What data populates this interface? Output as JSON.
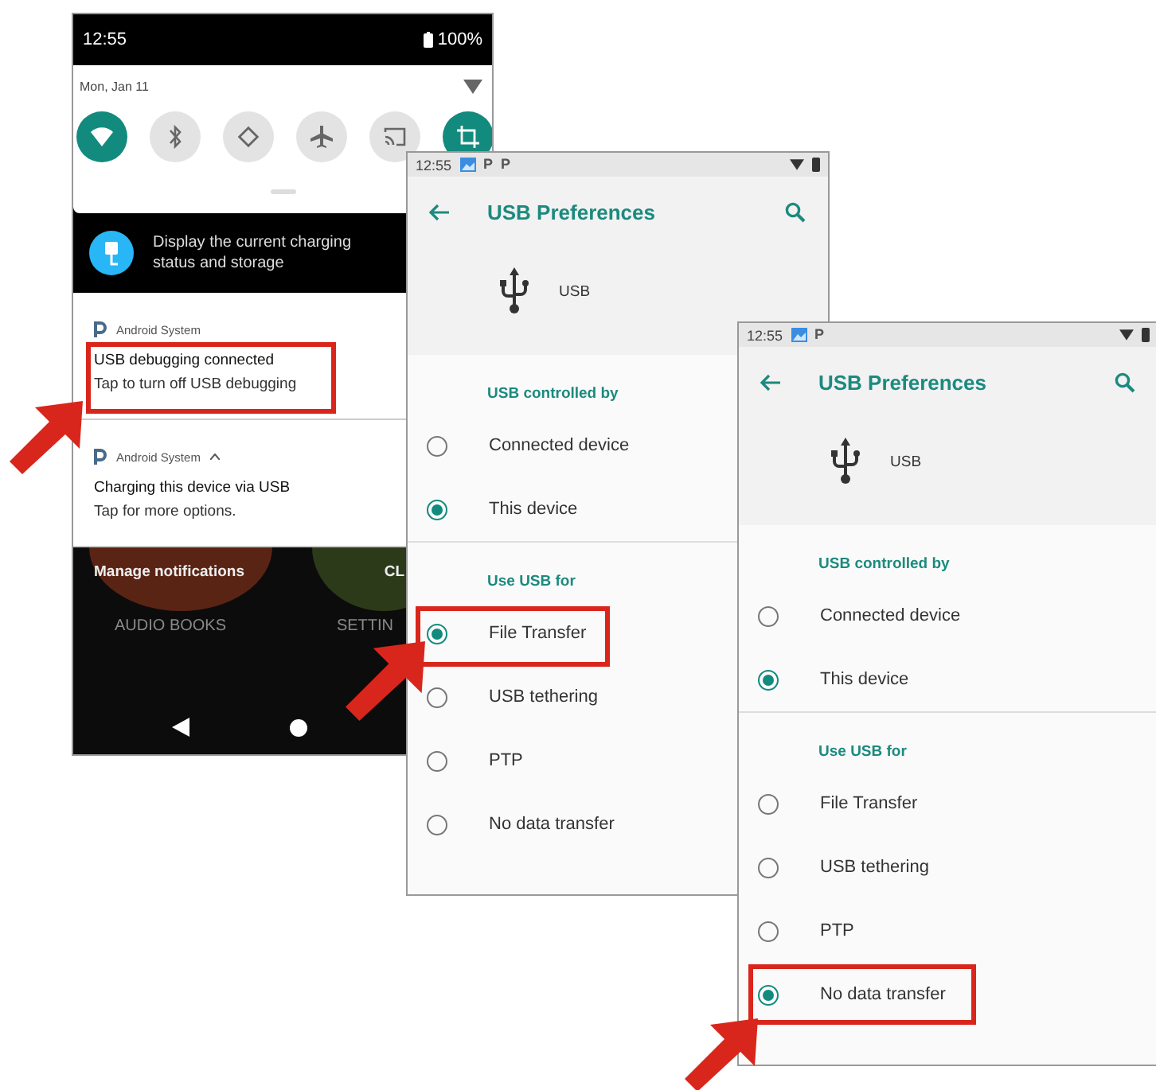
{
  "notification_shade": {
    "status_bar": {
      "time": "12:55",
      "battery": "100%"
    },
    "date": "Mon, Jan 11",
    "quick_tiles": [
      {
        "on": true
      },
      {
        "on": false
      },
      {
        "on": false
      },
      {
        "on": false
      },
      {
        "on": false
      },
      {
        "on": true
      }
    ],
    "charging_banner": "Display the current charging status and storage",
    "notifications": [
      {
        "app": "Android System",
        "expanded": false,
        "title": "USB debugging connected",
        "text": "Tap to turn off USB debugging"
      },
      {
        "app": "Android System",
        "expanded": true,
        "title": "Charging this device via USB",
        "text": "Tap for more options."
      }
    ],
    "manage_notifications": "Manage notifications",
    "clear_all": "CL",
    "app_labels": [
      "AUDIO BOOKS",
      "SETTIN"
    ]
  },
  "preference_screens": [
    {
      "time": "12:55",
      "notification_icons": [
        "P",
        "P"
      ],
      "title": "USB Preferences",
      "device": "USB",
      "sections": [
        {
          "heading": "USB controlled by",
          "options": [
            {
              "label": "Connected device",
              "selected": false
            },
            {
              "label": "This device",
              "selected": true
            }
          ]
        },
        {
          "heading": "Use USB for",
          "options": [
            {
              "label": "File Transfer",
              "selected": true
            },
            {
              "label": "USB tethering",
              "selected": false
            },
            {
              "label": "PTP",
              "selected": false
            },
            {
              "label": "No data transfer",
              "selected": false
            }
          ]
        }
      ]
    },
    {
      "time": "12:55",
      "notification_icons": [
        "P"
      ],
      "title": "USB Preferences",
      "device": "USB",
      "sections": [
        {
          "heading": "USB controlled by",
          "options": [
            {
              "label": "Connected device",
              "selected": false
            },
            {
              "label": "This device",
              "selected": true
            }
          ]
        },
        {
          "heading": "Use USB for",
          "options": [
            {
              "label": "File Transfer",
              "selected": false
            },
            {
              "label": "USB tethering",
              "selected": false
            },
            {
              "label": "PTP",
              "selected": false
            },
            {
              "label": "No data transfer",
              "selected": true
            }
          ]
        }
      ]
    }
  ]
}
